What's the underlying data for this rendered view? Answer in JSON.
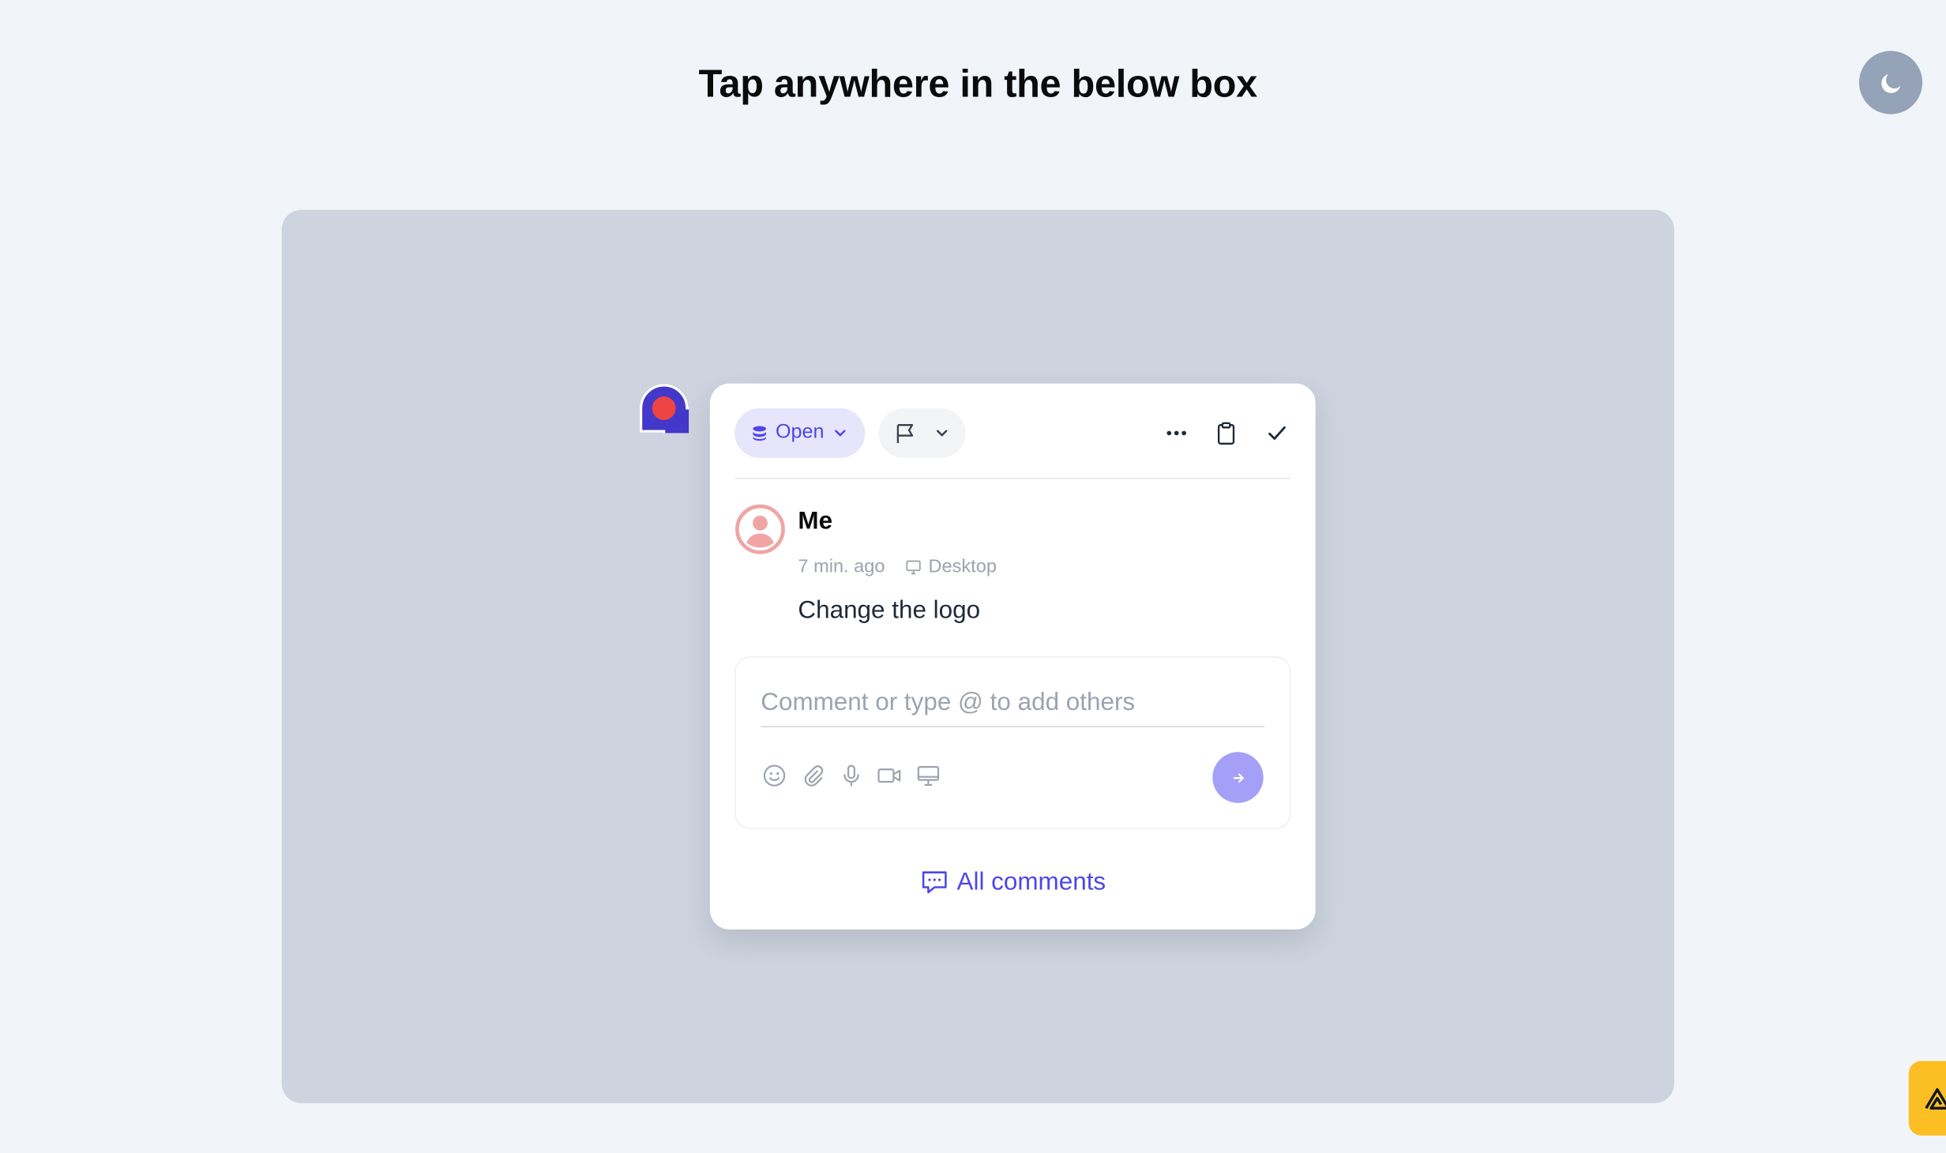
{
  "page": {
    "title": "Tap anywhere in the below box"
  },
  "theme_toggle": {
    "icon": "moon-icon"
  },
  "comment": {
    "status_label": "Open",
    "author": "Me",
    "time": "7 min. ago",
    "device": "Desktop",
    "text": "Change the logo"
  },
  "composer": {
    "placeholder": "Comment or type @ to add others",
    "tools": [
      "emoji-icon",
      "paperclip-icon",
      "microphone-icon",
      "video-icon",
      "screen-icon"
    ]
  },
  "footer": {
    "all_comments_label": "All comments"
  },
  "colors": {
    "accent": "#4f46e5",
    "pin_outer": "#4338ca",
    "pin_inner": "#ef4444",
    "canvas": "#cdd4df",
    "background": "#f1f5f9",
    "send": "#a5a0f7",
    "fab": "#fbbf24"
  }
}
